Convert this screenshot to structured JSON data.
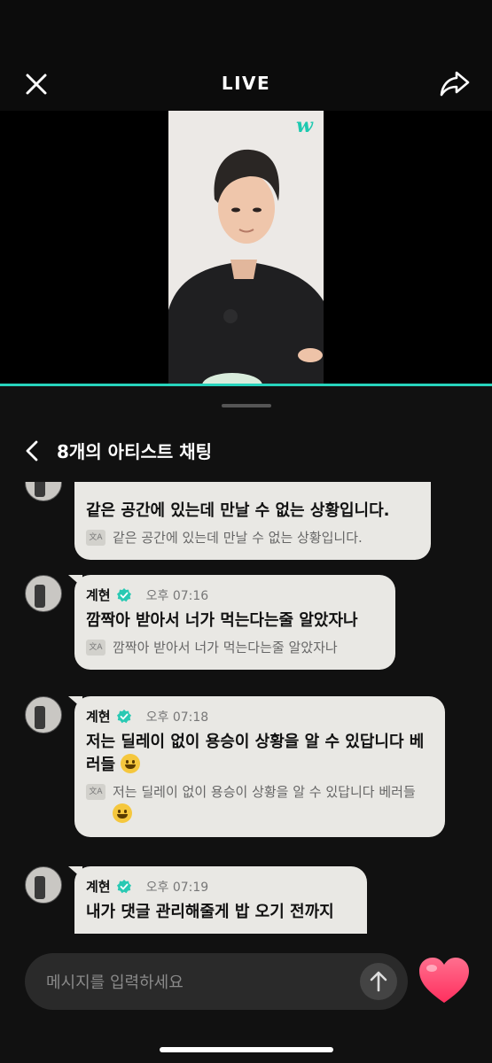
{
  "header": {
    "title": "LIVE"
  },
  "video": {
    "logo": "w"
  },
  "chat": {
    "title": "8개의 아티스트 채팅",
    "translate_icon_label": "文A",
    "messages": [
      {
        "author": "",
        "time": "",
        "text": "같은 공간에 있는데  만날 수 없는 상황입니다.",
        "translation": "같은 공간에 있는데  만날 수 없는 상황입니다."
      },
      {
        "author": "계현",
        "time": "오후 07:16",
        "text": "깜짝아 받아서 너가 먹는다는줄 알았자나",
        "translation": "깜짝아 받아서 너가 먹는다는줄 알았자나"
      },
      {
        "author": "계현",
        "time": "오후 07:18",
        "text": "저는 딜레이 없이 용승이 상황을 알 수 있답니다 베러들",
        "translation": "저는 딜레이 없이 용승이 상황을 알 수 있답니다 베러들",
        "emoji": "grinning-face"
      },
      {
        "author": "계현",
        "time": "오후 07:19",
        "text": "내가 댓글 관리해줄게 밥 오기 전까지",
        "translation": ""
      }
    ]
  },
  "composer": {
    "placeholder": "메시지를 입력하세요"
  },
  "colors": {
    "accent": "#27d4bd",
    "bubble": "#e9e8e4",
    "background": "#111111",
    "heart": "#ff3b6b"
  }
}
